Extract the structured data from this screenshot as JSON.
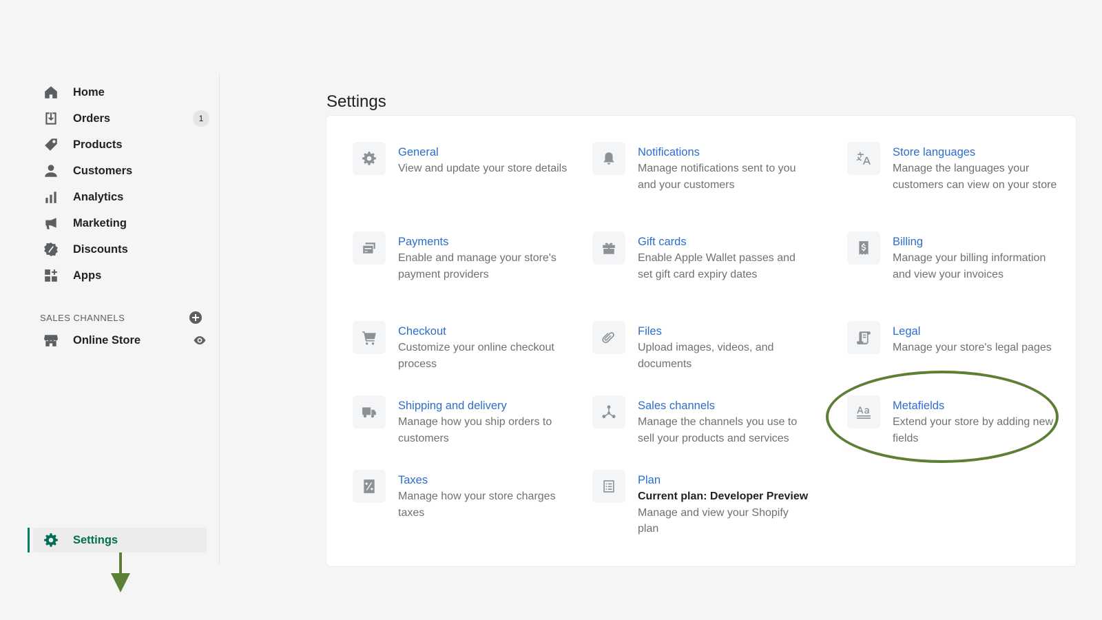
{
  "sidebar": {
    "items": [
      {
        "label": "Home",
        "icon": "home-icon"
      },
      {
        "label": "Orders",
        "icon": "orders-icon",
        "badge": "1"
      },
      {
        "label": "Products",
        "icon": "tag-icon"
      },
      {
        "label": "Customers",
        "icon": "person-icon"
      },
      {
        "label": "Analytics",
        "icon": "bar-chart-icon"
      },
      {
        "label": "Marketing",
        "icon": "megaphone-icon"
      },
      {
        "label": "Discounts",
        "icon": "discount-icon"
      },
      {
        "label": "Apps",
        "icon": "apps-icon"
      }
    ],
    "sales_channels_heading": "SALES CHANNELS",
    "online_store_label": "Online Store",
    "settings_label": "Settings"
  },
  "main": {
    "title": "Settings",
    "tiles": [
      {
        "title": "General",
        "desc": "View and update your store details",
        "icon": "gear-icon"
      },
      {
        "title": "Notifications",
        "desc": "Manage notifications sent to you and your customers",
        "icon": "bell-icon"
      },
      {
        "title": "Store languages",
        "desc": "Manage the languages your customers can view on your store",
        "icon": "translate-icon"
      },
      {
        "title": "Payments",
        "desc": "Enable and manage your store's payment providers",
        "icon": "payment-icon"
      },
      {
        "title": "Gift cards",
        "desc": "Enable Apple Wallet passes and set gift card expiry dates",
        "icon": "gift-icon"
      },
      {
        "title": "Billing",
        "desc": "Manage your billing information and view your invoices",
        "icon": "billing-icon"
      },
      {
        "title": "Checkout",
        "desc": "Customize your online checkout process",
        "icon": "cart-icon"
      },
      {
        "title": "Files",
        "desc": "Upload images, videos, and documents",
        "icon": "paperclip-icon"
      },
      {
        "title": "Legal",
        "desc": "Manage your store's legal pages",
        "icon": "legal-icon"
      },
      {
        "title": "Shipping and delivery",
        "desc": "Manage how you ship orders to customers",
        "icon": "truck-icon"
      },
      {
        "title": "Sales channels",
        "desc": "Manage the channels you use to sell your products and services",
        "icon": "channels-icon"
      },
      {
        "title": "Metafields",
        "desc": "Extend your store by adding new fields",
        "icon": "metafields-icon"
      },
      {
        "title": "Taxes",
        "desc": "Manage how your store charges taxes",
        "icon": "taxes-icon"
      },
      {
        "title": "Plan",
        "sub": "Current plan: Developer Preview",
        "desc": "Manage and view your Shopify plan",
        "icon": "plan-icon"
      }
    ]
  },
  "colors": {
    "link": "#2c6ecb",
    "annotation": "#5b7f34",
    "settings_active": "#006e52"
  }
}
